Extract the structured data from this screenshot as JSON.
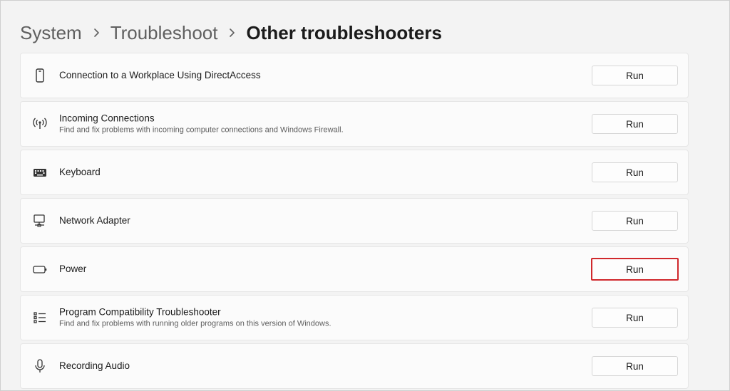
{
  "breadcrumb": {
    "items": [
      "System",
      "Troubleshoot",
      "Other troubleshooters"
    ],
    "separator_icon": "chevron-right-icon"
  },
  "colors": {
    "page_background": "#f3f3f3",
    "card_background": "#fbfbfb",
    "highlight_border": "#d0282c"
  },
  "troubleshooters": [
    {
      "icon": "phone-device-icon",
      "title": "Connection to a Workplace Using DirectAccess",
      "description": "",
      "button_label": "Run",
      "highlighted": false
    },
    {
      "icon": "wireless-signal-icon",
      "title": "Incoming Connections",
      "description": "Find and fix problems with incoming computer connections and Windows Firewall.",
      "button_label": "Run",
      "highlighted": false
    },
    {
      "icon": "keyboard-icon",
      "title": "Keyboard",
      "description": "",
      "button_label": "Run",
      "highlighted": false
    },
    {
      "icon": "network-adapter-icon",
      "title": "Network Adapter",
      "description": "",
      "button_label": "Run",
      "highlighted": false
    },
    {
      "icon": "battery-icon",
      "title": "Power",
      "description": "",
      "button_label": "Run",
      "highlighted": true
    },
    {
      "icon": "list-icon",
      "title": "Program Compatibility Troubleshooter",
      "description": "Find and fix problems with running older programs on this version of Windows.",
      "button_label": "Run",
      "highlighted": false
    },
    {
      "icon": "microphone-icon",
      "title": "Recording Audio",
      "description": "",
      "button_label": "Run",
      "highlighted": false
    }
  ]
}
